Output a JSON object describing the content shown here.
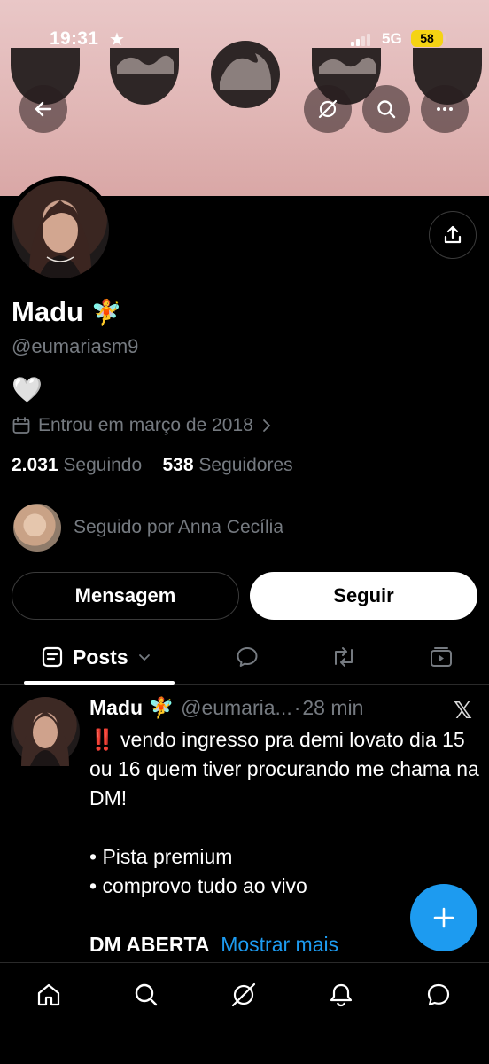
{
  "status": {
    "time": "19:31",
    "network": "5G",
    "battery": "58"
  },
  "profile": {
    "name": "Madu",
    "name_emoji": "🧚",
    "handle": "@eumariasm9",
    "bio": "🤍",
    "joined": "Entrou em março de 2018",
    "following_count": "2.031",
    "following_label": "Seguindo",
    "followers_count": "538",
    "followers_label": "Seguidores",
    "followed_by": "Seguido por Anna Cecília"
  },
  "actions": {
    "message": "Mensagem",
    "follow": "Seguir"
  },
  "tabs": {
    "posts": "Posts"
  },
  "post": {
    "name": "Madu",
    "emoji": "🧚",
    "handle": "@eumaria...",
    "separator": "·",
    "time": "28 min",
    "alert": "‼️",
    "line1": " vendo ingresso  pra demi lovato dia 15 ou 16 quem tiver procurando me chama na DM!",
    "bullet1": "• Pista premium",
    "bullet2": "• comprovo tudo ao vivo",
    "line_last": "DM ABERTA",
    "show_more": "Mostrar mais"
  },
  "icons": [
    "back-arrow-icon",
    "grok-icon",
    "search-icon",
    "more-icon",
    "share-icon",
    "calendar-icon",
    "chevron-right-icon",
    "chevron-down-icon",
    "reply-icon",
    "retweet-icon",
    "media-icon",
    "x-logo-icon",
    "plus-icon",
    "home-icon",
    "notifications-icon",
    "messages-icon"
  ],
  "colors": {
    "accent": "#1d9bf0",
    "banner": "#e1b7b6",
    "muted": "#757a80"
  }
}
